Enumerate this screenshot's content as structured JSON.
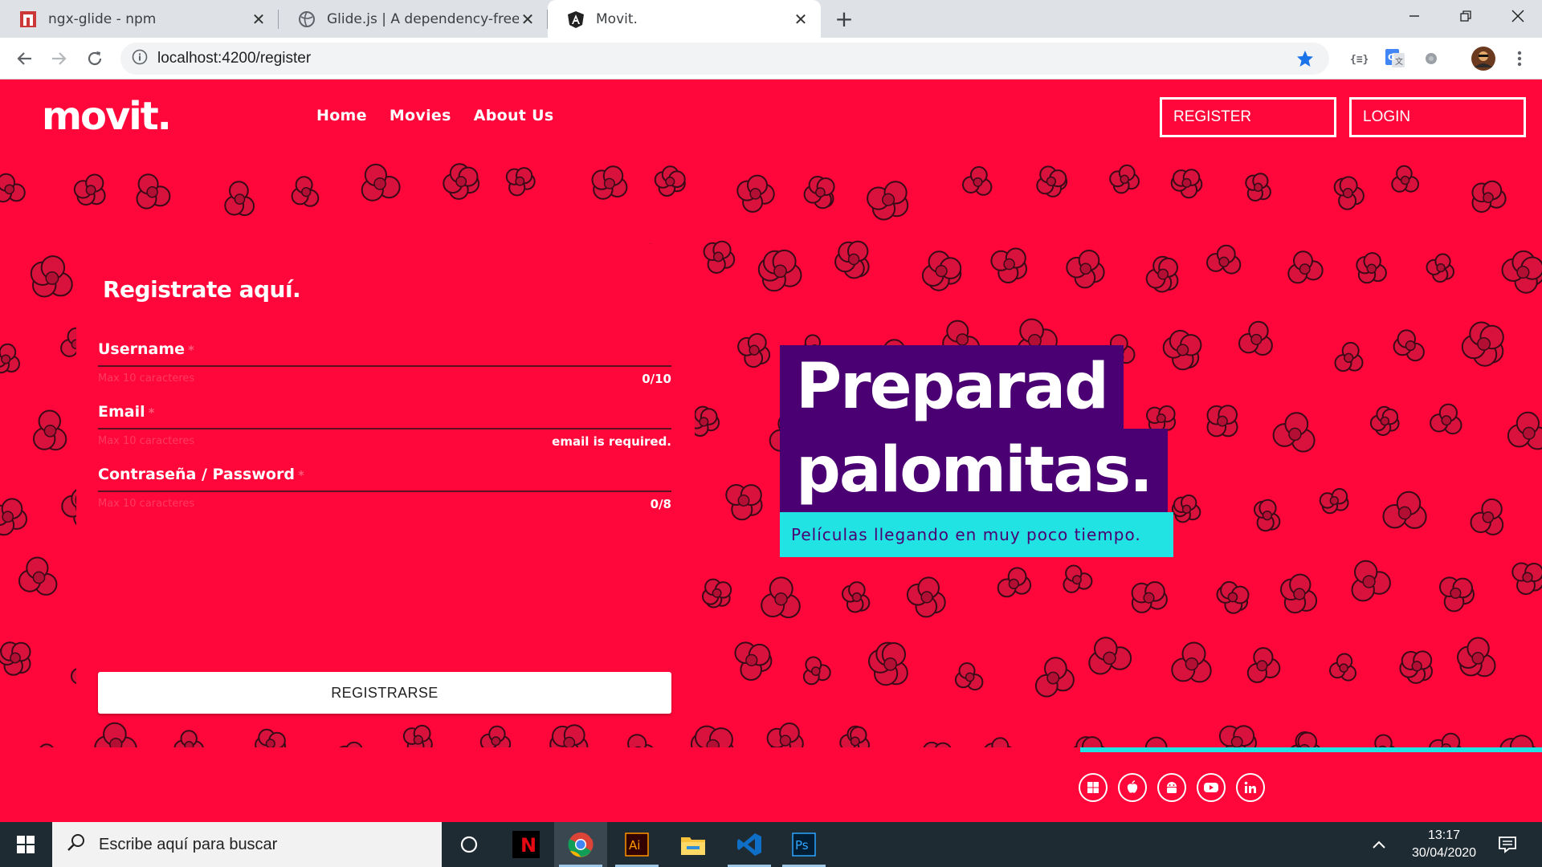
{
  "browser": {
    "tabs": [
      {
        "title": "ngx-glide - npm",
        "favicon": "npm-icon",
        "active": false
      },
      {
        "title": "Glide.js | A dependency-free Java",
        "favicon": "globe-icon",
        "active": false
      },
      {
        "title": "Movit.",
        "favicon": "angular-icon",
        "active": true
      }
    ],
    "url": "localhost:4200/register"
  },
  "site": {
    "logo": "movit.",
    "nav": [
      "Home",
      "Movies",
      "About Us"
    ],
    "register_label": "REGISTER",
    "login_label": "LOGIN"
  },
  "form": {
    "title": "Registrate aquí.",
    "required_mark": "*",
    "fields": [
      {
        "label": "Username",
        "hint": "Max 10 caracteres",
        "status": "0/10"
      },
      {
        "label": "Email",
        "hint": "Max 10 caracteres",
        "status": "email is required."
      },
      {
        "label": "Contraseña / Password",
        "hint": "Max 10 caracteres",
        "status": "0/8"
      }
    ],
    "submit_label": "REGISTRARSE"
  },
  "hero": {
    "line1": "Preparad",
    "line2": "palomitas.",
    "subtitle": "Películas llegando en muy poco tiempo."
  },
  "social_icons": [
    "windows-icon",
    "apple-icon",
    "android-icon",
    "youtube-icon",
    "linkedin-icon"
  ],
  "taskbar": {
    "search_placeholder": "Escribe aquí para buscar",
    "apps": [
      "netflix",
      "chrome",
      "illustrator",
      "file-explorer",
      "vscode",
      "photoshop"
    ],
    "illustrator_label": "Ai",
    "photoshop_label": "Ps",
    "netflix_label": "N",
    "time": "13:17",
    "date": "30/04/2020"
  },
  "colors": {
    "page_bg": "#ff073a",
    "hero_purple": "#4a0072",
    "accent_cyan": "#21e3e3"
  }
}
